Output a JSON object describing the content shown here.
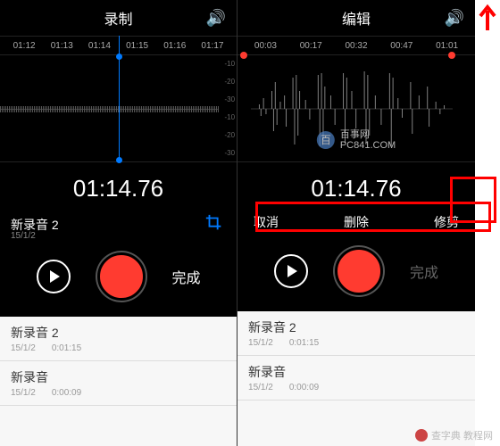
{
  "left": {
    "title": "录制",
    "timeline": [
      "01:12",
      "01:13",
      "01:14",
      "01:15",
      "01:16",
      "01:17"
    ],
    "bigTime": "01:14.76",
    "recName": "新录音 2",
    "recDate": "15/1/2",
    "doneLabel": "完成",
    "scale": [
      "-10",
      "-20",
      "-30",
      "-10",
      "-20",
      "-30"
    ]
  },
  "right": {
    "title": "编辑",
    "timeline": [
      "00:03",
      "00:17",
      "00:32",
      "00:47",
      "01:01"
    ],
    "bigTime": "01:14.76",
    "actions": {
      "cancel": "取消",
      "delete": "删除",
      "trim": "修剪"
    },
    "doneLabel": "完成",
    "watermark": {
      "name": "百事网",
      "url": "PC841.COM"
    }
  },
  "list": [
    {
      "title": "新录音 2",
      "date": "15/1/2",
      "dur": "0:01:15"
    },
    {
      "title": "新录音",
      "date": "15/1/2",
      "dur": "0:00:09"
    }
  ],
  "footerWm": "查字典 教程网"
}
